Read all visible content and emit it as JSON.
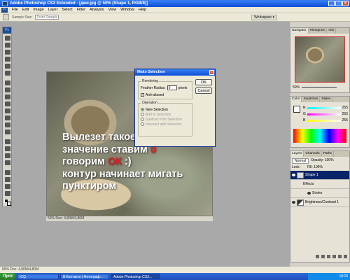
{
  "window": {
    "title": "Adobe Photoshop CS3 Extended - [джи.jpg @ 50% (Shape 1, RGB/8)]"
  },
  "menu": [
    "File",
    "Edit",
    "Image",
    "Layer",
    "Select",
    "Filter",
    "Analysis",
    "View",
    "Window",
    "Help"
  ],
  "options": {
    "sample_label": "Sample Size:",
    "sample_value": "Point Sample",
    "workspace": "Workspace ▾"
  },
  "toolbox": {
    "label": "Ps"
  },
  "document": {
    "overlay": {
      "line1": "Вылезет такое окошко -",
      "line2a": "значение ставим ",
      "line2b": "0",
      "line3a": "говорим ",
      "line3b": "ОК",
      "line3c": " :)",
      "line4": "контур начинает мигать",
      "line5": "пунктиром"
    },
    "status": "50%   Doc: 4,80M/4,80M"
  },
  "dialog": {
    "title": "Make Selection",
    "rendering_label": "Rendering",
    "feather_label": "Feather Radius:",
    "feather_value": "0",
    "feather_unit": "pixels",
    "antialias_label": "Anti-aliased",
    "operation_label": "Operation",
    "ops": [
      "New Selection",
      "Add to Selection",
      "Subtract from Selection",
      "Intersect with Selection"
    ],
    "ok": "OK",
    "cancel": "Cancel"
  },
  "panels": {
    "nav_tabs": [
      "Navigator",
      "Histogram",
      "Info"
    ],
    "nav_zoom": "50%",
    "color_tabs": [
      "Color",
      "Swatches",
      "Styles"
    ],
    "color_values": {
      "r": "255",
      "g": "255",
      "b": "255"
    },
    "layers_tabs": [
      "Layers",
      "Channels",
      "Paths"
    ],
    "blend_mode": "Normal",
    "opacity_label": "Opacity: 100%",
    "lock_label": "Lock:",
    "fill_label": "Fill: 100%",
    "layers": [
      {
        "name": "Shape 1"
      },
      {
        "name": "Effects"
      },
      {
        "name": "Stroke"
      },
      {
        "name": "Brightness/Contrast 1"
      }
    ]
  },
  "statusline": "50%   Doc: 4,80M/4,80M",
  "taskbar": {
    "start": "Пуск",
    "items": [
      "ICQ",
      "В Контакте | Фотограф...",
      "Adobe Photoshop CS3..."
    ],
    "time": "18:29"
  }
}
